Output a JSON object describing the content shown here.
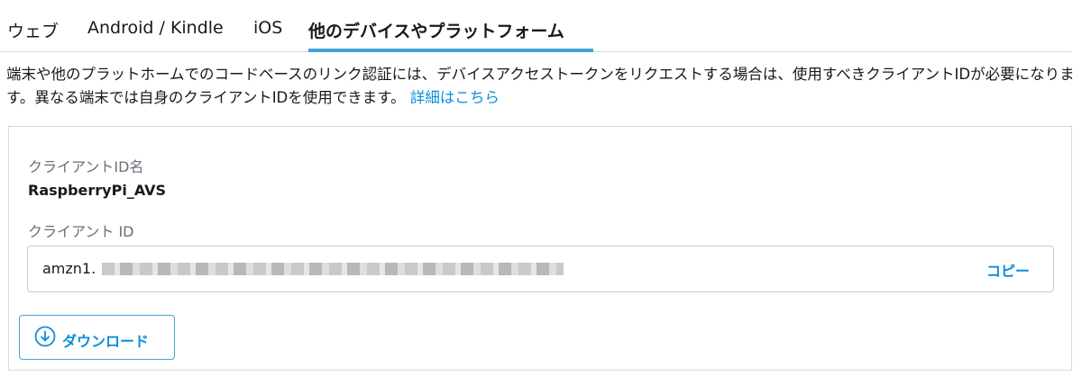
{
  "tabs": [
    {
      "label": "ウェブ"
    },
    {
      "label": "Android / Kindle"
    },
    {
      "label": "iOS"
    },
    {
      "label": "他のデバイスやプラットフォーム",
      "active": true
    }
  ],
  "description": {
    "text": "端末や他のプラットホームでのコードベースのリンク認証には、デバイスアクセストークンをリクエストする場合は、使用すべきクライアントIDが必要になります。異なる端末では自身のクライアントIDを使用できます。",
    "link": "詳細はこちら"
  },
  "client": {
    "name_label": "クライアントID名",
    "name_value": "RaspberryPi_AVS",
    "id_label": "クライアント ID",
    "id_value_prefix": "amzn1.",
    "copy_label": "コピー"
  },
  "download": {
    "label": "ダウンロード",
    "icon": "download-circle-icon"
  },
  "colors": {
    "accent": "#44a4d9",
    "link": "#0c8ed9",
    "muted": "#687078",
    "border": "#d5dbdb"
  }
}
